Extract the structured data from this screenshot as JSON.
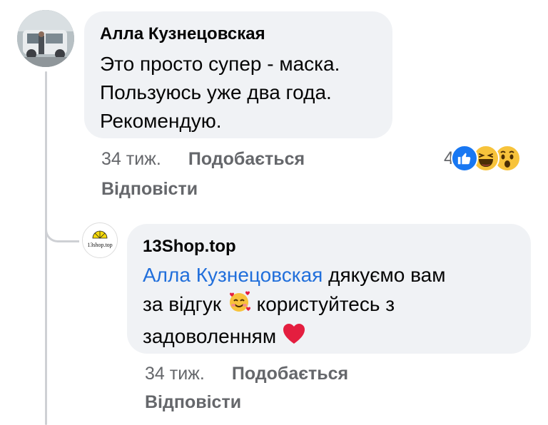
{
  "comment": {
    "author": "Алла Кузнецовская",
    "text_lines": [
      "Это просто супер - маска.",
      "Пользуюсь уже два года.",
      "Рекомендую."
    ],
    "time": "34 тиж.",
    "like_label": "Подобається",
    "reply_label": "Відповісти",
    "reaction_count": "4",
    "reaction_icons": [
      "like-icon",
      "haha-icon",
      "wow-icon"
    ]
  },
  "reply": {
    "author": "13Shop.top",
    "avatar_text": "13shop.top",
    "mention": "Алла Кузнецовская",
    "text_part1": " дякуємо вам",
    "text_line2a": "за відгук ",
    "emoji1": "smiling-face-with-hearts-emoji",
    "text_line2b": " користуйтесь з",
    "text_line3": "задоволенням ",
    "emoji2": "red-heart-emoji",
    "time": "34 тиж.",
    "like_label": "Подобається",
    "reply_label": "Відповісти"
  },
  "colors": {
    "bubble_bg": "#f0f2f5",
    "secondary_text": "#65676b",
    "mention": "#216fdb",
    "like_blue": "#1877f2",
    "heart_red": "#e41e3f"
  }
}
